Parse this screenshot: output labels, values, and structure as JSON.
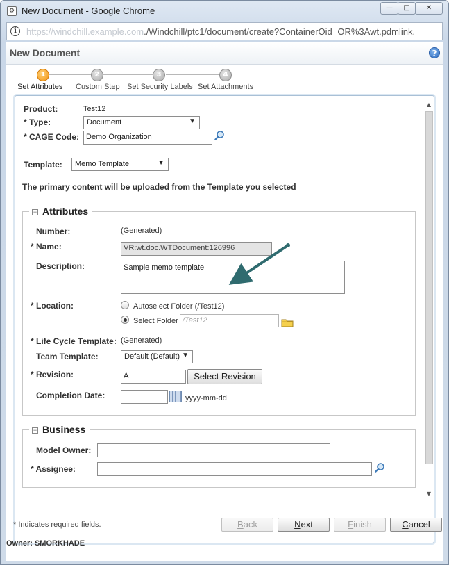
{
  "window": {
    "title": "New Document - Google Chrome",
    "controls": {
      "minimize": "—",
      "maximize": "□",
      "close": "✕"
    }
  },
  "address_bar": {
    "host_blurred": "https://windchill.example.com",
    "url_visible": "./Windchill/ptc1/document/create?ContainerOid=OR%3Awt.pdmlink."
  },
  "page": {
    "title": "New Document",
    "help_label": "?"
  },
  "wizard": {
    "steps": [
      {
        "number": "1",
        "label": "Set Attributes",
        "active": true
      },
      {
        "number": "2",
        "label": "Custom Step",
        "active": false
      },
      {
        "number": "3",
        "label": "Set Security Labels",
        "active": false
      },
      {
        "number": "4",
        "label": "Set Attachments",
        "active": false
      }
    ]
  },
  "form": {
    "product_label": "Product:",
    "product_value": "Test12",
    "type_label": "* Type:",
    "type_value": "Document",
    "cage_label": "* CAGE Code:",
    "cage_value": "Demo Organization",
    "template_label": "Template:",
    "template_value": "Memo Template",
    "primary_content_note": "The primary content will be uploaded from the Template you selected"
  },
  "attributes": {
    "legend": "Attributes",
    "number_label": "Number:",
    "number_value": "(Generated)",
    "name_label": "* Name:",
    "name_value": "VR:wt.doc.WTDocument:126996",
    "description_label": "Description:",
    "description_value": "Sample memo template",
    "location_label": "* Location:",
    "autoselect_label": "Autoselect Folder (/Test12)",
    "select_folder_label": "Select Folder",
    "select_folder_value": "/Test12",
    "lifecycle_label": "* Life Cycle Template:",
    "lifecycle_value": "(Generated)",
    "team_label": "Team Template:",
    "team_value": "Default (Default)",
    "revision_label": "* Revision:",
    "revision_value": "A",
    "select_revision_button": "Select Revision",
    "completion_label": "Completion Date:",
    "completion_value": "",
    "date_format_hint": "yyyy-mm-dd"
  },
  "business": {
    "legend": "Business",
    "model_owner_label": "Model Owner:",
    "model_owner_value": "",
    "assignee_label": "* Assignee:",
    "assignee_value": ""
  },
  "footer": {
    "required_note": "* Indicates required fields.",
    "back_button": "Back",
    "next_button": "Next",
    "finish_button": "Finish",
    "cancel_button": "Cancel",
    "owner_text": "Owner: SMORKHADE"
  },
  "colors": {
    "accent_step": "#f29411",
    "annotation_arrow": "#2f6b6f",
    "help_icon": "#2e6cc1"
  }
}
